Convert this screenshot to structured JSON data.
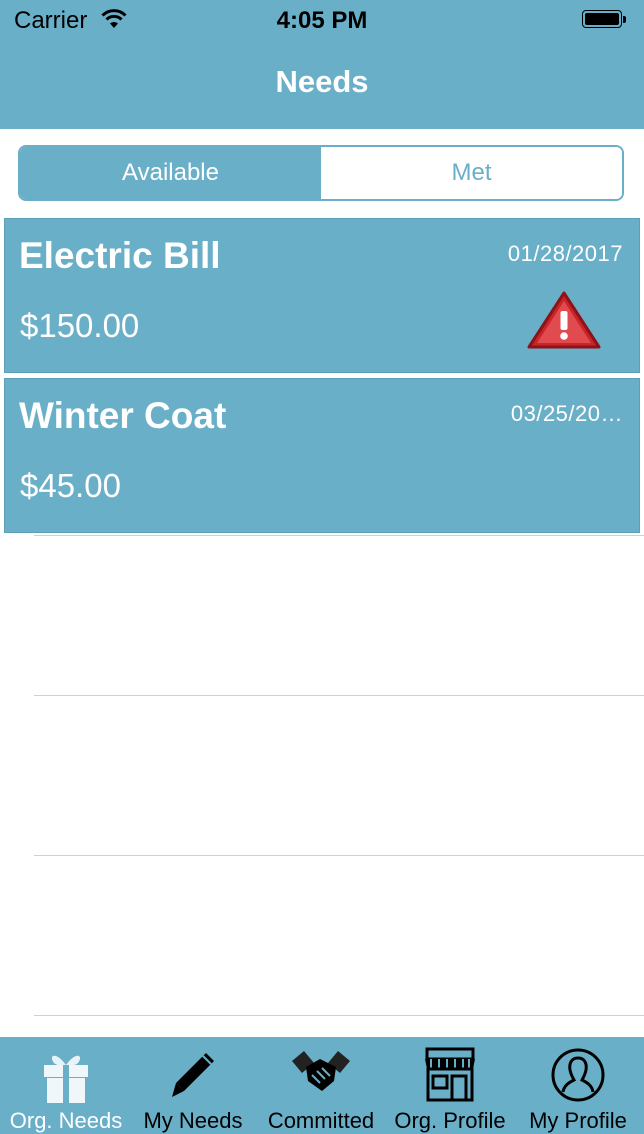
{
  "status_bar": {
    "carrier": "Carrier",
    "time": "4:05 PM"
  },
  "nav": {
    "title": "Needs"
  },
  "segment": {
    "options": [
      "Available",
      "Met"
    ],
    "selected": "Available"
  },
  "needs": [
    {
      "name": "Electric Bill",
      "date": "01/28/2017",
      "amount": "$150.00",
      "alert": true
    },
    {
      "name": "Winter Coat",
      "date": "03/25/20…",
      "amount": "$45.00",
      "alert": false
    }
  ],
  "tabs": [
    {
      "label": "Org. Needs",
      "icon": "gift-icon",
      "active": true
    },
    {
      "label": "My Needs",
      "icon": "pencil-icon",
      "active": false
    },
    {
      "label": "Committed",
      "icon": "handshake-icon",
      "active": false
    },
    {
      "label": "Org. Profile",
      "icon": "storefront-icon",
      "active": false
    },
    {
      "label": "My Profile",
      "icon": "user-circle-icon",
      "active": false
    }
  ],
  "colors": {
    "accent": "#6aafc8",
    "alert": "#c8242a"
  }
}
